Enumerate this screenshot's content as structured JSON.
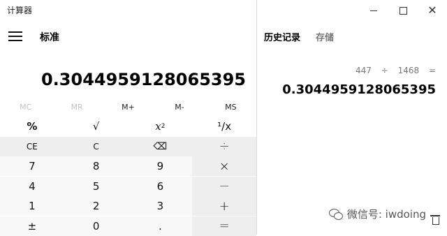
{
  "app": {
    "title": "计算器",
    "mode": "标准"
  },
  "display": {
    "value": "0.3044959128065395"
  },
  "memory": {
    "buttons": [
      {
        "label": "MC",
        "enabled": false
      },
      {
        "label": "MR",
        "enabled": false
      },
      {
        "label": "M+",
        "enabled": true
      },
      {
        "label": "M-",
        "enabled": true
      },
      {
        "label": "MS",
        "enabled": true
      }
    ]
  },
  "keys": {
    "row1": [
      "%",
      "√",
      "x",
      "2",
      "¹/x"
    ],
    "row2": [
      "CE",
      "C",
      "⌫",
      "÷"
    ],
    "row3": [
      "7",
      "8",
      "9",
      "×"
    ],
    "row4": [
      "4",
      "5",
      "6",
      "—"
    ],
    "row5": [
      "1",
      "2",
      "3",
      "+"
    ],
    "row6": [
      "±",
      "0",
      ".",
      "="
    ]
  },
  "tabs": {
    "history": "历史记录",
    "memory": "存储"
  },
  "history": {
    "operand1": "447",
    "operator": "÷",
    "operand2": "1468",
    "equals": "=",
    "result": "0.3044959128065395"
  },
  "watermark": {
    "text": "微信号: iwdoing"
  },
  "colors": {
    "keypad_num": "#f8f8f8",
    "keypad_fn": "#eeeeee",
    "disabled": "#c2c2c2"
  }
}
